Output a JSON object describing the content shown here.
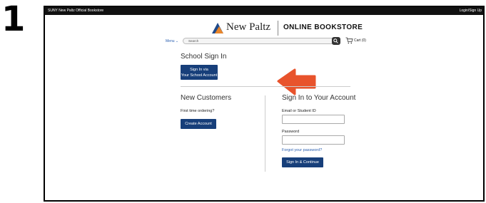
{
  "step_number": "1",
  "topbar": {
    "site_name": "SUNY New Paltz Official Bookstore",
    "login_link": "Login/Sign Up"
  },
  "header": {
    "campus_name": "New Paltz",
    "store_name": "ONLINE BOOKSTORE"
  },
  "nav": {
    "menu_label": "Menu ⌄",
    "search_placeholder": "Search",
    "cart_label": "Cart (0)"
  },
  "school_signin": {
    "heading": "School Sign In",
    "button_line1": "Sign In via",
    "button_line2": "Your School Account"
  },
  "new_customers": {
    "heading": "New Customers",
    "prompt": "First time ordering?",
    "create_button": "Create Account"
  },
  "account_signin": {
    "heading": "Sign In to Your Account",
    "email_label": "Email or Student ID",
    "email_value": "",
    "password_label": "Password",
    "password_value": "",
    "forgot_link": "Forgot your password?",
    "submit_button": "Sign In & Continue"
  },
  "colors": {
    "primary_button": "#173f7a",
    "link": "#2a5fb0",
    "annotation_arrow": "#e8532c",
    "logo_orange": "#e8862c"
  },
  "icons": {
    "logo": "new-paltz-logo-icon",
    "search": "search-icon",
    "cart": "cart-icon",
    "annotation": "pointer-arrow-icon"
  }
}
